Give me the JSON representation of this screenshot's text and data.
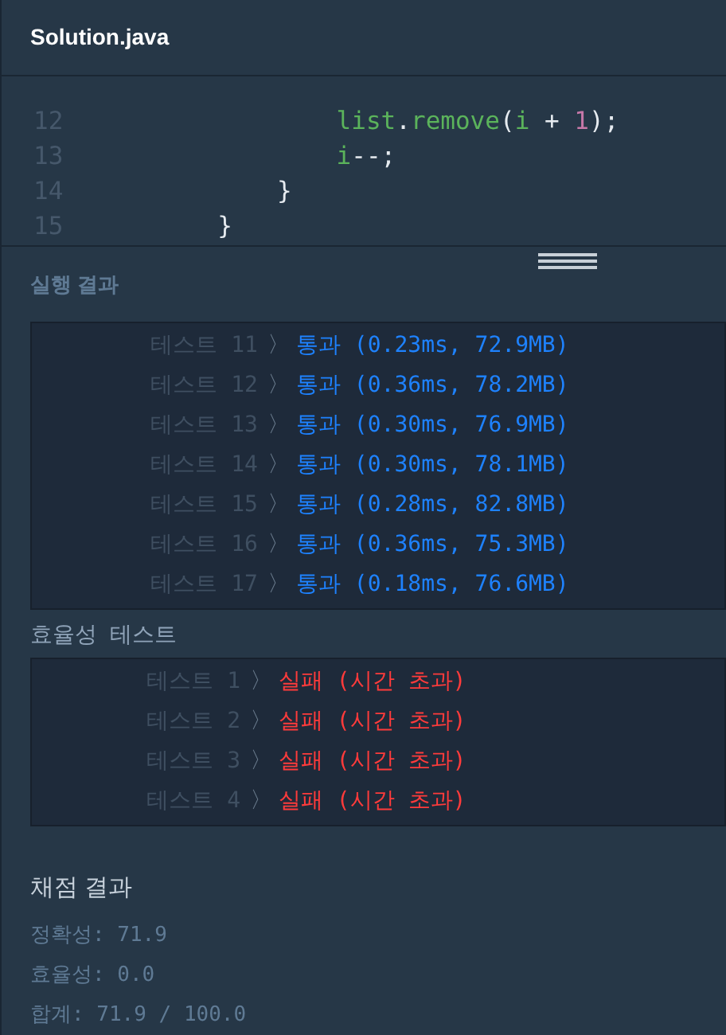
{
  "file_title": "Solution.java",
  "code_lines": [
    {
      "number": "12",
      "tokens": [
        {
          "kind": "ident",
          "text": "                list"
        },
        {
          "kind": "punct",
          "text": "."
        },
        {
          "kind": "ident",
          "text": "remove"
        },
        {
          "kind": "punct",
          "text": "("
        },
        {
          "kind": "ident",
          "text": "i"
        },
        {
          "kind": "punct",
          "text": " + "
        },
        {
          "kind": "num",
          "text": "1"
        },
        {
          "kind": "punct",
          "text": ");"
        }
      ]
    },
    {
      "number": "13",
      "tokens": [
        {
          "kind": "ident",
          "text": "                i"
        },
        {
          "kind": "punct",
          "text": "--;"
        }
      ]
    },
    {
      "number": "14",
      "tokens": [
        {
          "kind": "punct",
          "text": "            }"
        }
      ]
    },
    {
      "number": "15",
      "tokens": [
        {
          "kind": "punct",
          "text": "        }"
        }
      ]
    }
  ],
  "result_title": "실행 결과",
  "accuracy_tests": [
    {
      "label": "테스트 11",
      "arrow": "〉",
      "kind": "pass",
      "result": "통과 (0.23ms, 72.9MB)"
    },
    {
      "label": "테스트 12",
      "arrow": "〉",
      "kind": "pass",
      "result": "통과 (0.36ms, 78.2MB)"
    },
    {
      "label": "테스트 13",
      "arrow": "〉",
      "kind": "pass",
      "result": "통과 (0.30ms, 76.9MB)"
    },
    {
      "label": "테스트 14",
      "arrow": "〉",
      "kind": "pass",
      "result": "통과 (0.30ms, 78.1MB)"
    },
    {
      "label": "테스트 15",
      "arrow": "〉",
      "kind": "pass",
      "result": "통과 (0.28ms, 82.8MB)"
    },
    {
      "label": "테스트 16",
      "arrow": "〉",
      "kind": "pass",
      "result": "통과 (0.36ms, 75.3MB)"
    },
    {
      "label": "테스트 17",
      "arrow": "〉",
      "kind": "pass",
      "result": "통과 (0.18ms, 76.6MB)"
    }
  ],
  "efficiency_heading": "효율성  테스트",
  "efficiency_tests": [
    {
      "label": "테스트 1",
      "arrow": "〉",
      "kind": "fail",
      "result": "실패 (시간 초과)"
    },
    {
      "label": "테스트 2",
      "arrow": "〉",
      "kind": "fail",
      "result": "실패 (시간 초과)"
    },
    {
      "label": "테스트 3",
      "arrow": "〉",
      "kind": "fail",
      "result": "실패 (시간 초과)"
    },
    {
      "label": "테스트 4",
      "arrow": "〉",
      "kind": "fail",
      "result": "실패 (시간 초과)"
    }
  ],
  "score_title": "채점 결과",
  "scores": [
    "정확성: 71.9",
    "효율성: 0.0",
    "합계: 71.9 / 100.0"
  ]
}
